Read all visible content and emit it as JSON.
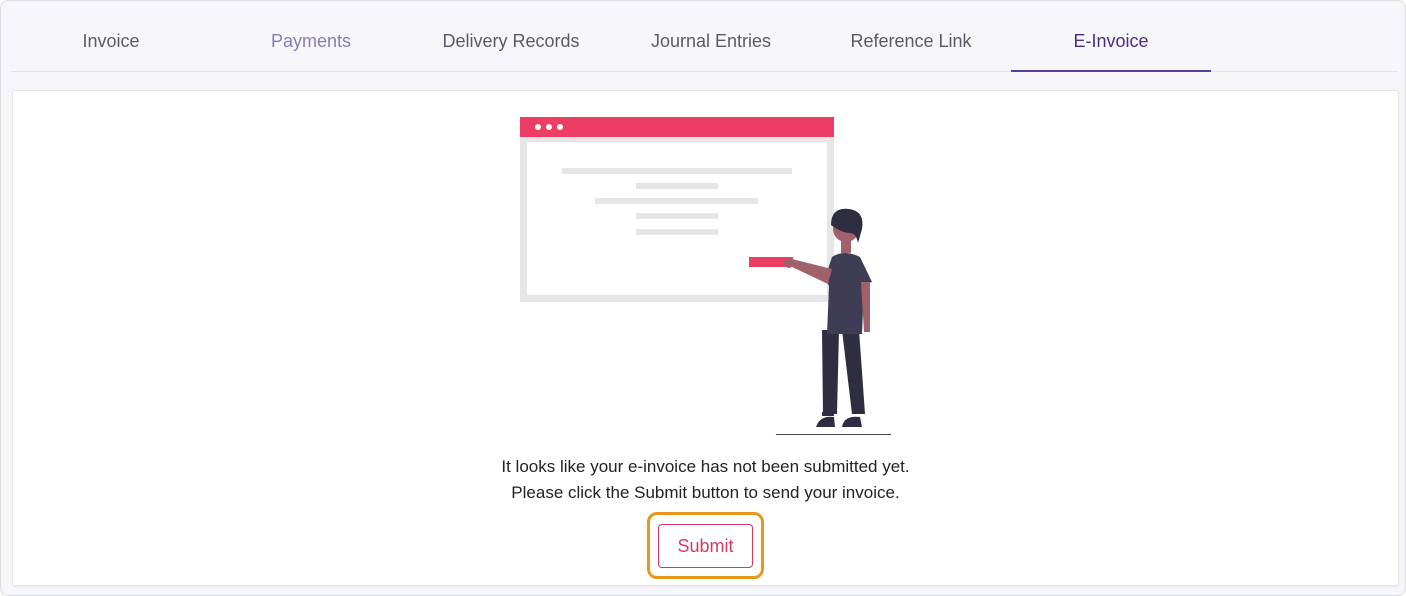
{
  "tabs": [
    {
      "label": "Invoice",
      "state": "default"
    },
    {
      "label": "Payments",
      "state": "hovered"
    },
    {
      "label": "Delivery Records",
      "state": "default"
    },
    {
      "label": "Journal Entries",
      "state": "default"
    },
    {
      "label": "Reference Link",
      "state": "default"
    },
    {
      "label": "E-Invoice",
      "state": "active"
    }
  ],
  "empty_state": {
    "illustration": "person-presenting-browser-window",
    "line1": "It looks like your e-invoice has not been submitted yet.",
    "line2": "Please click the Submit button to send your invoice.",
    "submit_label": "Submit"
  },
  "colors": {
    "accent": "#5b3e9a",
    "brand_pink": "#ec3e63",
    "highlight": "#e8961c"
  }
}
